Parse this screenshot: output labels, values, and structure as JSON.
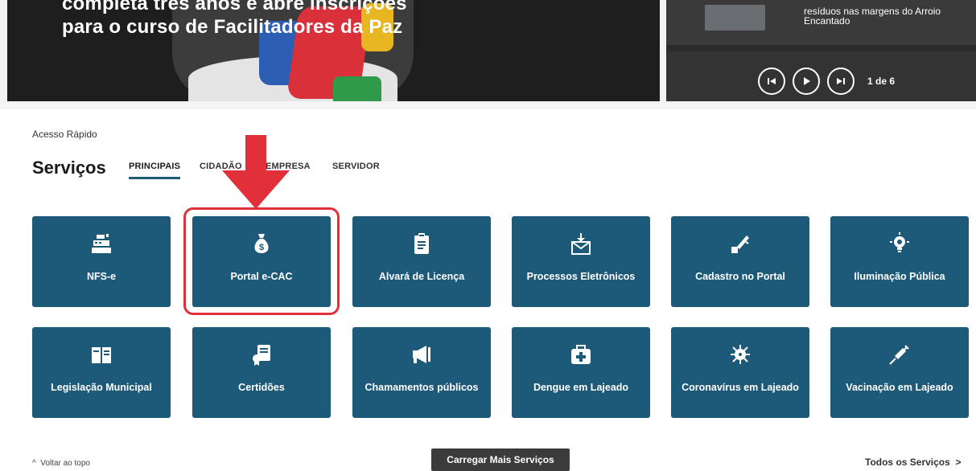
{
  "hero": {
    "title": "completa três anos e abre inscrições para o curso de Facilitadores da Paz",
    "side_text": "resíduos nas margens do Arroio Encantado",
    "pager": "1 de 6",
    "controls": [
      "previous-icon",
      "play-icon",
      "next-icon"
    ]
  },
  "quick_access": {
    "label": "Acesso Rápido",
    "title": "Serviços",
    "tabs": [
      "PRINCIPAIS",
      "CIDADÃO",
      "EMPRESA",
      "SERVIDOR"
    ]
  },
  "services": [
    {
      "label": "NFS-e",
      "icon": "cash-register-icon"
    },
    {
      "label": "Portal e-CAC",
      "icon": "money-bag-icon"
    },
    {
      "label": "Alvará de Licença",
      "icon": "clipboard-icon"
    },
    {
      "label": "Processos Eletrônicos",
      "icon": "mail-download-icon"
    },
    {
      "label": "Cadastro no Portal",
      "icon": "pen-signature-icon"
    },
    {
      "label": "Iluminação Pública",
      "icon": "lightbulb-icon"
    },
    {
      "label": "Legislação Municipal",
      "icon": "book-icon"
    },
    {
      "label": "Certidões",
      "icon": "certificate-icon"
    },
    {
      "label": "Chamamentos públicos",
      "icon": "megaphone-icon"
    },
    {
      "label": "Dengue em Lajeado",
      "icon": "medkit-icon"
    },
    {
      "label": "Coronavírus em Lajeado",
      "icon": "virus-icon"
    },
    {
      "label": "Vacinação em Lajeado",
      "icon": "syringe-icon"
    }
  ],
  "footer": {
    "back_to_top": "Voltar ao topo",
    "load_more": "Carregar Mais Serviços",
    "all_services": "Todos os Serviços"
  },
  "colors": {
    "card": "#1d5a79",
    "highlight": "#e2303a",
    "tab_underline": "#1f5c75"
  }
}
